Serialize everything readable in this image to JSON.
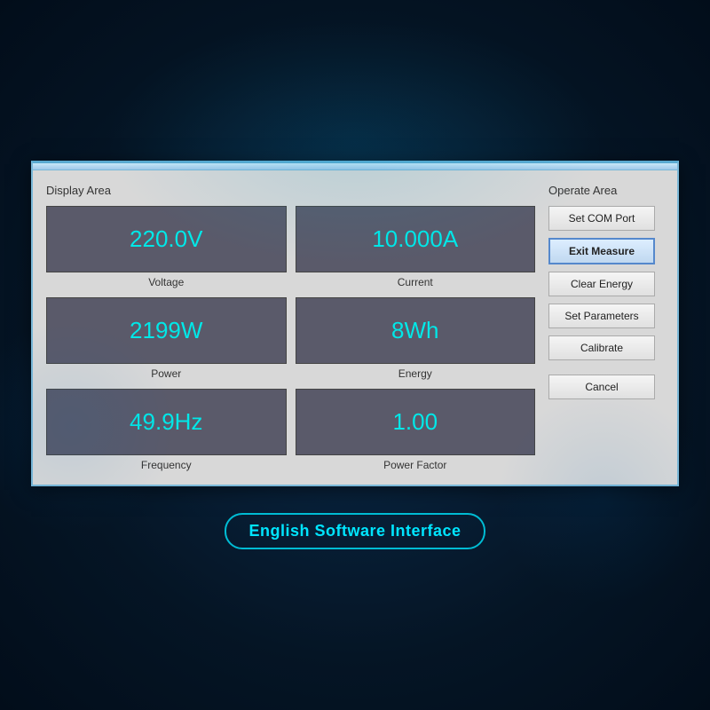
{
  "window": {
    "display_area_label": "Display Area",
    "operate_area_label": "Operate Area"
  },
  "meters": [
    {
      "id": "voltage",
      "value": "220.0V",
      "label": "Voltage"
    },
    {
      "id": "current",
      "value": "10.000A",
      "label": "Current"
    },
    {
      "id": "power",
      "value": "2199W",
      "label": "Power"
    },
    {
      "id": "energy",
      "value": "8Wh",
      "label": "Energy"
    },
    {
      "id": "frequency",
      "value": "49.9Hz",
      "label": "Frequency"
    },
    {
      "id": "power-factor",
      "value": "1.00",
      "label": "Power Factor"
    }
  ],
  "buttons": [
    {
      "id": "set-com-port",
      "label": "Set COM Port",
      "active": false
    },
    {
      "id": "exit-measure",
      "label": "Exit Measure",
      "active": true
    },
    {
      "id": "clear-energy",
      "label": "Clear Energy",
      "active": false
    },
    {
      "id": "set-parameters",
      "label": "Set Parameters",
      "active": false
    },
    {
      "id": "calibrate",
      "label": "Calibrate",
      "active": false
    },
    {
      "id": "cancel",
      "label": "Cancel",
      "active": false
    }
  ],
  "bottom_label": "English Software Interface"
}
